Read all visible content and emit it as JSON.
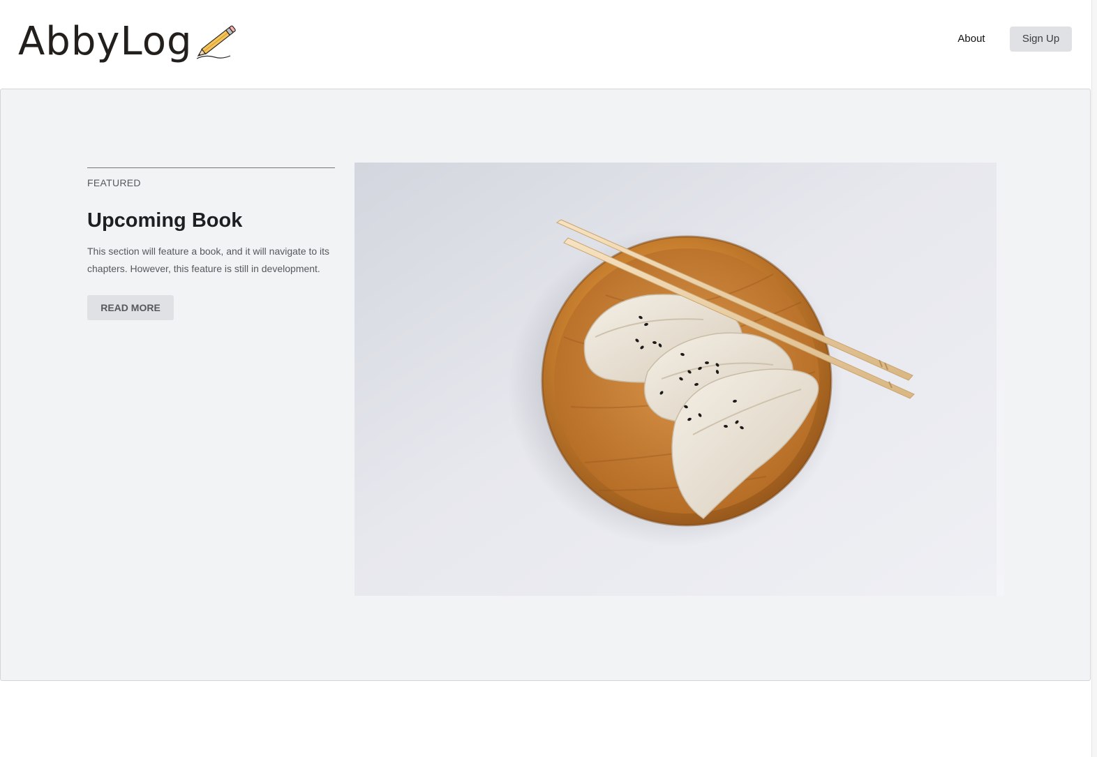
{
  "header": {
    "logo_text": "AbbyLog",
    "nav": {
      "about_label": "About",
      "signup_label": "Sign Up"
    }
  },
  "featured": {
    "label": "FEATURED",
    "title": "Upcoming Book",
    "description": "This section will feature a book, and it will navigate to its chapters. However, this feature is still in development.",
    "button_label": "READ MORE",
    "image_subject": "dumplings-on-wooden-plate-with-chopsticks"
  },
  "colors": {
    "panel_background": "#f2f3f5",
    "button_background": "#e0e1e4",
    "title_text": "#1e1f22",
    "body_text": "#55585d",
    "plate_wood": "#c67a30"
  }
}
